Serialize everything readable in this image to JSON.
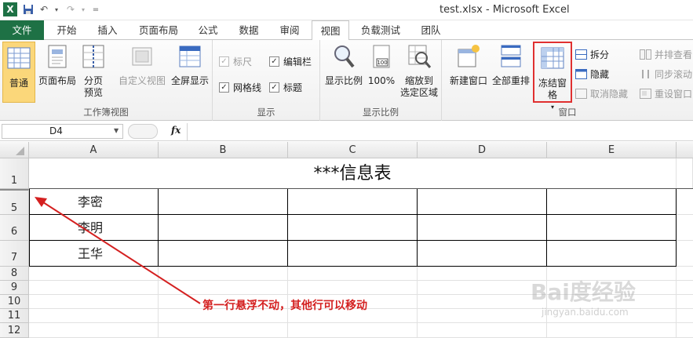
{
  "window": {
    "title": "test.xlsx  -  Microsoft Excel"
  },
  "tabs": [
    {
      "label": "文件"
    },
    {
      "label": "开始"
    },
    {
      "label": "插入"
    },
    {
      "label": "页面布局"
    },
    {
      "label": "公式"
    },
    {
      "label": "数据"
    },
    {
      "label": "审阅"
    },
    {
      "label": "视图"
    },
    {
      "label": "负载测试"
    },
    {
      "label": "团队"
    }
  ],
  "ribbon": {
    "workbook_views": {
      "label": "工作簿视图",
      "normal": "普通",
      "page_layout": "页面布局",
      "page_break_line1": "分页",
      "page_break_line2": "预览",
      "custom_views": "自定义视图",
      "full_screen": "全屏显示"
    },
    "show": {
      "label": "显示",
      "ruler": "标尺",
      "formula_bar": "编辑栏",
      "gridlines": "网格线",
      "headings": "标题"
    },
    "zoom": {
      "label": "显示比例",
      "zoom": "显示比例",
      "hundred": "100%",
      "zoom_sel_line1": "缩放到",
      "zoom_sel_line2": "选定区域",
      "icon_text": "100"
    },
    "window": {
      "label": "窗口",
      "new_window": "新建窗口",
      "arrange_all": "全部重排",
      "freeze_panes": "冻结窗格",
      "split": "拆分",
      "hide": "隐藏",
      "unhide": "取消隐藏",
      "side_by_side": "并排查看",
      "sync_scroll": "同步滚动",
      "reset_pos": "重设窗口"
    }
  },
  "formula_bar": {
    "name_box": "D4",
    "fx": "fx",
    "value": ""
  },
  "columns": [
    "A",
    "B",
    "C",
    "D",
    "E"
  ],
  "rows": [
    "1",
    "5",
    "6",
    "7",
    "8",
    "9",
    "10",
    "11",
    "12"
  ],
  "cells": {
    "title": "***信息表",
    "a5": "李密",
    "a6": "李明",
    "a7": "王华"
  },
  "annotation": {
    "text": "第一行悬浮不动，其他行可以移动",
    "color": "#d42020"
  },
  "watermark": {
    "brand": "Bai度经验",
    "url": "jingyan.baidu.com"
  },
  "colors": {
    "file_tab": "#1e7145",
    "highlight": "#e03030",
    "selected_button": "#fbd77a"
  }
}
